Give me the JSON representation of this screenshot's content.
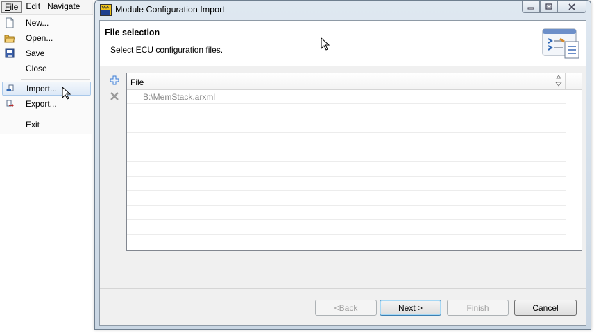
{
  "menubar": {
    "items": [
      {
        "label": "File",
        "mnemonic": "F",
        "rest": "ile"
      },
      {
        "label": "Edit",
        "mnemonic": "E",
        "rest": "dit"
      },
      {
        "label": "Navigate",
        "mnemonic": "N",
        "rest": "avigate"
      }
    ]
  },
  "file_menu": {
    "items": [
      {
        "label": "New...",
        "icon": "new-document-icon"
      },
      {
        "label": "Open...",
        "icon": "open-folder-icon"
      },
      {
        "label": "Save",
        "icon": "save-disk-icon"
      },
      {
        "label": "Close",
        "icon": ""
      },
      {
        "label": "Import...",
        "icon": "import-icon",
        "highlighted": true
      },
      {
        "label": "Export...",
        "icon": "export-icon"
      },
      {
        "label": "Exit",
        "icon": ""
      }
    ]
  },
  "dialog": {
    "title": "Module Configuration Import",
    "app_icon_text": "CFG",
    "header": {
      "title": "File selection",
      "description": "Select ECU configuration files."
    },
    "table": {
      "column": "File",
      "rows": [
        "B:\\MemStack.arxml"
      ]
    },
    "buttons": {
      "back": {
        "label": "< Back",
        "prefix": "< ",
        "mnemonic": "B",
        "rest": "ack",
        "enabled": false
      },
      "next": {
        "label": "Next >",
        "mnemonic": "N",
        "rest": "ext >",
        "enabled": true
      },
      "finish": {
        "label": "Finish",
        "mnemonic": "F",
        "rest": "inish",
        "enabled": false
      },
      "cancel": {
        "label": "Cancel",
        "enabled": true
      }
    }
  },
  "colors": {
    "accent": "#3c7fb1",
    "add_icon": "#3a7bd5",
    "remove_icon": "#9a9a9a",
    "menu_highlight": "#dde9f7"
  }
}
